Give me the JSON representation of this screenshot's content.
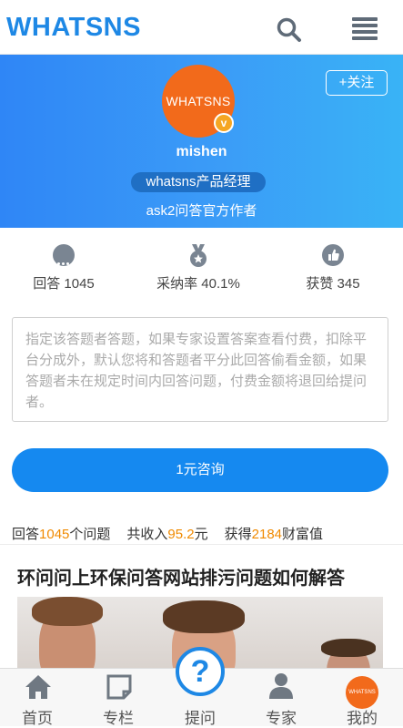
{
  "header": {
    "logo": "WHATSNS",
    "search_icon": "search-icon",
    "menu_icon": "hamburger-menu-icon"
  },
  "profile": {
    "avatar_text": "WHATSNS",
    "verified_badge": "v",
    "follow_label": "+关注",
    "name": "mishen",
    "title": "whatsns产品经理",
    "description": "ask2问答官方作者"
  },
  "stats": [
    {
      "icon": "chat-bubble-icon",
      "label": "回答 1045"
    },
    {
      "icon": "medal-icon",
      "label": "采纳率 40.1%"
    },
    {
      "icon": "thumbs-up-icon",
      "label": "获赞 345"
    }
  ],
  "question_input": {
    "placeholder": "指定该答题者答题，如果专家设置答案查看付费，扣除平台分成外，默认您将和答题者平分此回答偷看金额，如果答题者未在规定时间内回答问题，付费金额将退回给提问者。"
  },
  "consult_button": "1元咨询",
  "summary": {
    "answers_prefix": "回答",
    "answers_count": "1045",
    "answers_suffix": "个问题",
    "income_prefix": "共收入",
    "income_value": "95.2",
    "income_suffix": "元",
    "wealth_prefix": "获得",
    "wealth_value": "2184",
    "wealth_suffix": "财富值"
  },
  "featured_question": {
    "title": "环问问上环保问答网站排污问题如何解答"
  },
  "tabbar": {
    "items": [
      {
        "label": "首页",
        "icon": "home-icon"
      },
      {
        "label": "专栏",
        "icon": "note-icon"
      },
      {
        "label": "提问",
        "icon": "question-mark-icon"
      },
      {
        "label": "专家",
        "icon": "person-icon"
      },
      {
        "label": "我的",
        "icon": "avatar-icon"
      }
    ],
    "me_avatar_text": "WHATSNS"
  },
  "colors": {
    "brand": "#1e88e5",
    "accent_orange": "#f08a00",
    "avatar_orange": "#f26a1b"
  }
}
